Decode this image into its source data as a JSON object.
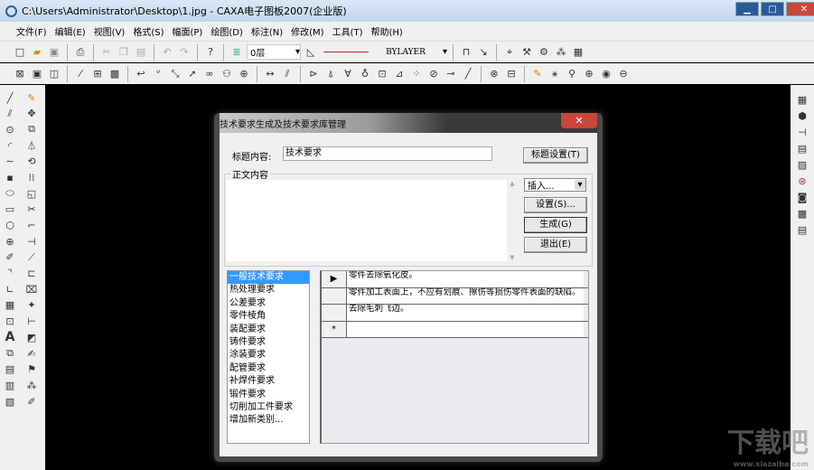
{
  "window": {
    "title": "C:\\Users\\Administrator\\Desktop\\1.jpg - CAXA电子图板2007(企业版)",
    "controls": [
      "▁",
      "□",
      "✕"
    ]
  },
  "menu": [
    "文件(F)",
    "编辑(E)",
    "视图(V)",
    "格式(S)",
    "幅面(P)",
    "绘图(D)",
    "标注(N)",
    "修改(M)",
    "工具(T)",
    "帮助(H)"
  ],
  "toolbar": {
    "layer": "0层",
    "linetype": "BYLAYER"
  },
  "dialog": {
    "title": "技术要求生成及技术要求库管理",
    "close": "✕",
    "title_label": "标题内容:",
    "title_value": "技术要求",
    "title_settings_button": "标题设置(T)",
    "body_group": "正文内容",
    "insert_select": "插入...",
    "settings_button": "设置(S)...",
    "generate_button": "生成(G)",
    "exit_button": "退出(E)",
    "categories": [
      "一般技术要求",
      "热处理要求",
      "公差要求",
      "零件棱角",
      "装配要求",
      "铸件要求",
      "涂装要求",
      "配管要求",
      "补焊件要求",
      "锻件要求",
      "切削加工件要求",
      "增加新类别..."
    ],
    "selected_category": "一般技术要求",
    "rows": [
      {
        "marker": "▶",
        "text": "零件去除氧化皮。"
      },
      {
        "marker": "",
        "text": "零件加工表面上，不应有划痕、擦伤等损伤零件表面的缺陷。"
      },
      {
        "marker": "",
        "text": "去除毛刺飞边。"
      },
      {
        "marker": "*",
        "text": ""
      }
    ]
  },
  "watermark": {
    "text": "下载吧",
    "url": "www.xiazaiba.com"
  }
}
